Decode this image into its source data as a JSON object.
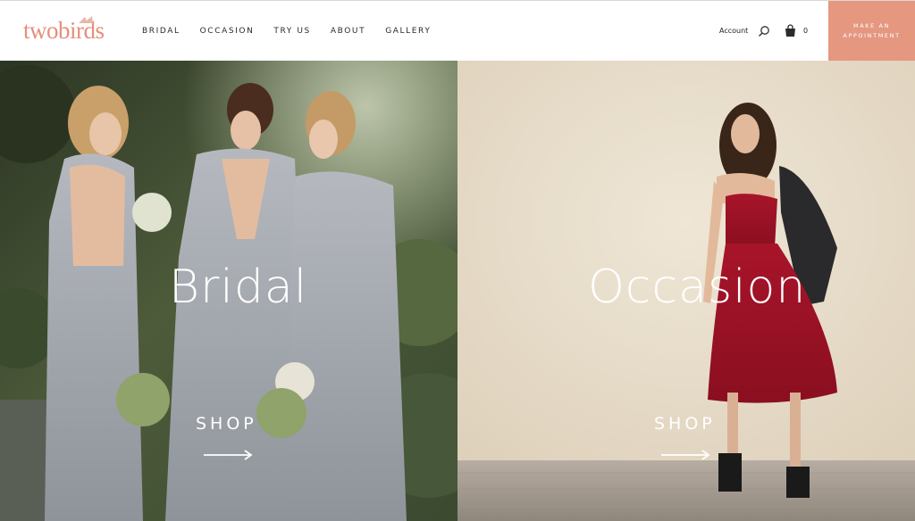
{
  "header": {
    "logo": {
      "part1": "two",
      "part2": "birds"
    },
    "nav": [
      {
        "label": "BRIDAL"
      },
      {
        "label": "OCCASION"
      },
      {
        "label": "TRY US"
      },
      {
        "label": "ABOUT"
      },
      {
        "label": "GALLERY"
      }
    ],
    "account_label": "Account",
    "cart_count": "0",
    "cta": {
      "line1": "MAKE AN",
      "line2": "APPOINTMENT"
    },
    "icons": {
      "search": "search-icon",
      "cart": "cart-icon"
    }
  },
  "hero": {
    "bridal": {
      "title": "Bridal",
      "shop_label": "SHOP",
      "arrow_icon": "arrow-right-icon"
    },
    "occasion": {
      "title": "Occasion",
      "shop_label": "SHOP",
      "arrow_icon": "arrow-right-icon"
    }
  },
  "colors": {
    "brand": "#e58f7b",
    "cta_bg": "#e59780",
    "text": "#2b2b2b"
  }
}
